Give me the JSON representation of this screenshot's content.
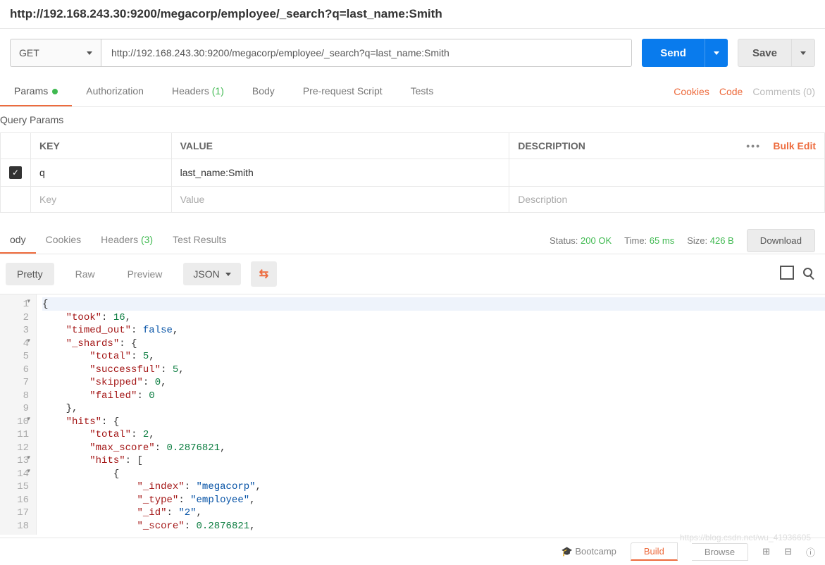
{
  "url_display": "http://192.168.243.30:9200/megacorp/employee/_search?q=last_name:Smith",
  "method": "GET",
  "url_input": "http://192.168.243.30:9200/megacorp/employee/_search?q=last_name:Smith",
  "send_label": "Send",
  "save_label": "Save",
  "request_tabs": {
    "params": "Params",
    "authorization": "Authorization",
    "headers": "Headers",
    "headers_count": "(1)",
    "body": "Body",
    "prerequest": "Pre-request Script",
    "tests": "Tests"
  },
  "right_links": {
    "cookies": "Cookies",
    "code": "Code",
    "comments": "Comments (0)"
  },
  "section_title": "Query Params",
  "table_headers": {
    "key": "KEY",
    "value": "VALUE",
    "description": "DESCRIPTION"
  },
  "bulk_edit": "Bulk Edit",
  "params": [
    {
      "checked": true,
      "key": "q",
      "value": "last_name:Smith",
      "description": ""
    }
  ],
  "placeholders": {
    "key": "Key",
    "value": "Value",
    "description": "Description"
  },
  "response_tabs": {
    "body": "ody",
    "cookies": "Cookies",
    "headers": "Headers",
    "headers_count": "(3)",
    "test_results": "Test Results"
  },
  "status": {
    "status_label": "Status:",
    "status_value": "200 OK",
    "time_label": "Time:",
    "time_value": "65 ms",
    "size_label": "Size:",
    "size_value": "426 B"
  },
  "download_label": "Download",
  "body_toolbar": {
    "pretty": "Pretty",
    "raw": "Raw",
    "preview": "Preview",
    "format": "JSON"
  },
  "response_lines": [
    "{",
    "    \"took\": 16,",
    "    \"timed_out\": false,",
    "    \"_shards\": {",
    "        \"total\": 5,",
    "        \"successful\": 5,",
    "        \"skipped\": 0,",
    "        \"failed\": 0",
    "    },",
    "    \"hits\": {",
    "        \"total\": 2,",
    "        \"max_score\": 0.2876821,",
    "        \"hits\": [",
    "            {",
    "                \"_index\": \"megacorp\",",
    "                \"_type\": \"employee\",",
    "                \"_id\": \"2\",",
    "                \"_score\": 0.2876821,"
  ],
  "fold_lines": [
    1,
    4,
    10,
    13,
    14
  ],
  "footer": {
    "bootcamp": "Bootcamp",
    "build": "Build",
    "browse": "Browse"
  },
  "watermark": "https://blog.csdn.net/wu_41936605"
}
